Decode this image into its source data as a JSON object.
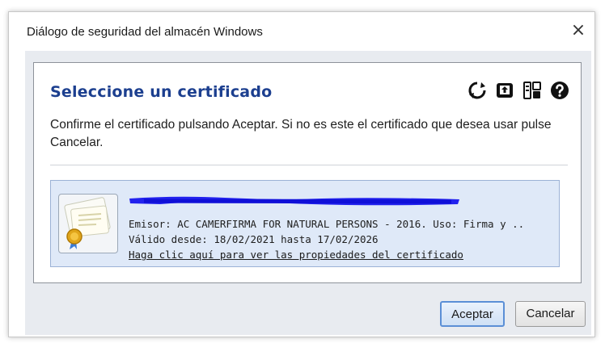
{
  "window": {
    "title": "Diálogo de seguridad del almacén Windows",
    "close_glyph": "×"
  },
  "panel": {
    "heading": "Seleccione un certificado",
    "message": "Confirme el certificado pulsando Aceptar. Si no es este el certificado que desea usar pulse Cancelar.",
    "toolbar_icons": [
      "refresh-icon",
      "export-icon",
      "details-icon",
      "help-icon"
    ]
  },
  "certificate": {
    "name_redacted": true,
    "issuer_line": "Emisor: AC CAMERFIRMA FOR NATURAL PERSONS - 2016. Uso: Firma y ..",
    "validity_line": "Válido desde: 18/02/2021 hasta 17/02/2026",
    "properties_link": "Haga clic aquí para ver las propiedades del certificado",
    "selected": true
  },
  "buttons": {
    "ok_label": "Aceptar",
    "cancel_label": "Cancelar"
  },
  "colors": {
    "heading": "#1c3f8f",
    "selection_bg": "#dfe9f8",
    "redaction": "#2222ee"
  }
}
